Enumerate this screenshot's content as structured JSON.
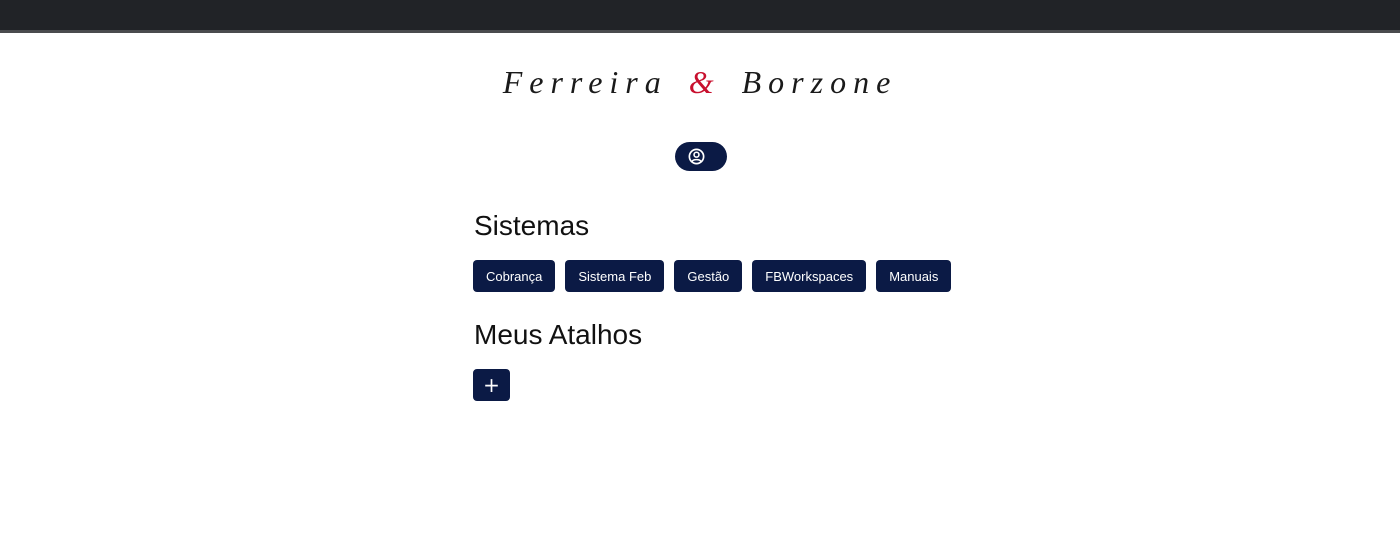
{
  "brand": {
    "first": "Ferreira",
    "ampersand": "&",
    "second": "Borzone"
  },
  "profile": {
    "icon": "user-circle-icon"
  },
  "sistemas": {
    "title": "Sistemas",
    "buttons": [
      {
        "label": "Cobrança"
      },
      {
        "label": "Sistema Feb"
      },
      {
        "label": "Gestão"
      },
      {
        "label": "FBWorkspaces"
      },
      {
        "label": "Manuais"
      }
    ]
  },
  "atalhos": {
    "title": "Meus Atalhos",
    "add_label": "+"
  },
  "colors": {
    "navy": "#0b1a45",
    "accent_red": "#c8102e",
    "topbar": "#212327"
  }
}
